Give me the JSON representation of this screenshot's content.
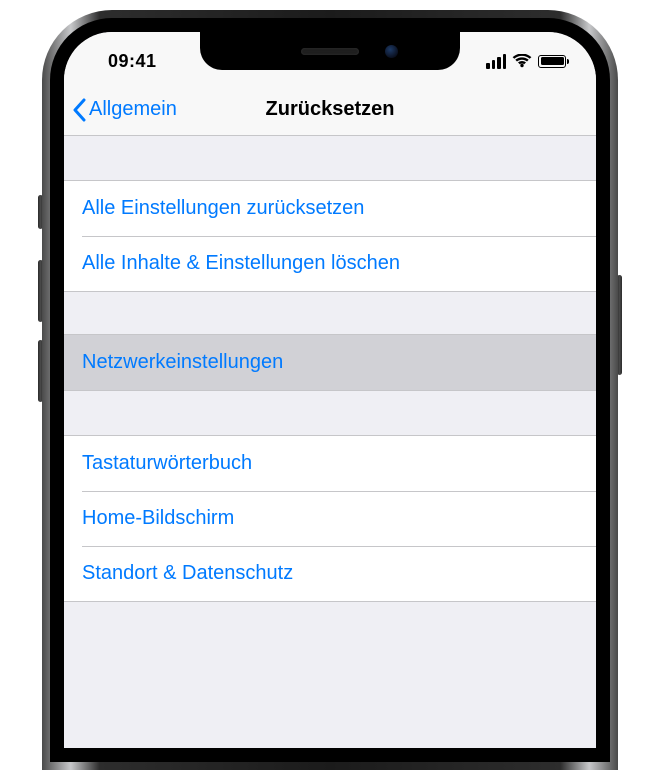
{
  "status": {
    "time": "09:41"
  },
  "navbar": {
    "back_label": "Allgemein",
    "title": "Zurücksetzen"
  },
  "groups": [
    {
      "items": [
        {
          "label": "Alle Einstellungen zurücksetzen",
          "selected": false
        },
        {
          "label": "Alle Inhalte & Einstellungen löschen",
          "selected": false
        }
      ]
    },
    {
      "items": [
        {
          "label": "Netzwerkeinstellungen",
          "selected": true
        }
      ]
    },
    {
      "items": [
        {
          "label": "Tastaturwörterbuch",
          "selected": false
        },
        {
          "label": "Home-Bildschirm",
          "selected": false
        },
        {
          "label": "Standort & Datenschutz",
          "selected": false
        }
      ]
    }
  ]
}
